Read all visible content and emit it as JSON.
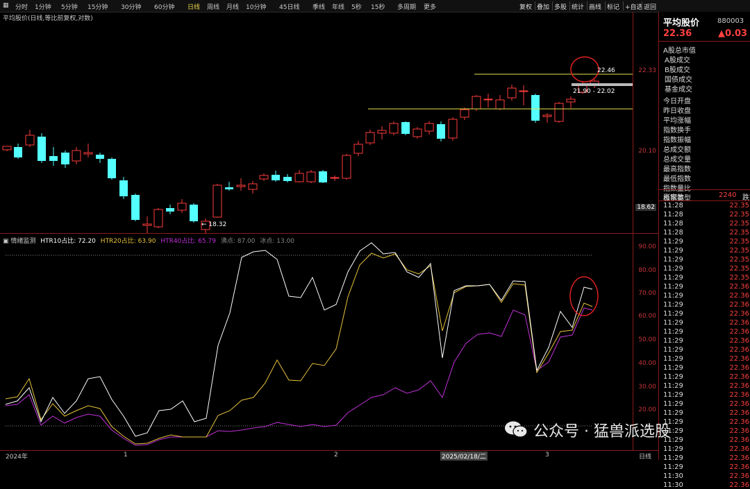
{
  "toolbar": {
    "timeframes": [
      "分时",
      "1分钟",
      "5分钟",
      "15分钟",
      "30分钟",
      "60分钟",
      "日线",
      "周线",
      "月线",
      "10分钟",
      "45日线",
      "季线",
      "年线",
      "5秒",
      "15秒",
      "多周期",
      "更多"
    ],
    "active": "日线",
    "right_buttons": [
      "复权",
      "叠加",
      "多股",
      "统计",
      "画线",
      "标记",
      "+自选",
      "返回"
    ]
  },
  "main": {
    "title": "平均股价(日线,等比前复权,对数)",
    "high_label": "22.46",
    "low_label": "← 18.32",
    "range_label": "21.90 - 22.02",
    "axis": [
      "22.33",
      "20.10",
      "18.62"
    ]
  },
  "indicator": {
    "title": "情绪监测",
    "htr10": "HTR10占比: 72.20",
    "htr20": "HTR20占比: 63.90",
    "htr40": "HTR40占比: 65.79",
    "hot": "沸点: 87.00",
    "cold": "冰点: 13.00",
    "axis": [
      "90.00",
      "80.00",
      "70.00",
      "60.00",
      "50.00",
      "40.00",
      "30.00",
      "20.00"
    ],
    "colors": {
      "htr10": "#ffffff",
      "htr20": "#e8c43a",
      "htr40": "#c030d8"
    }
  },
  "dates": {
    "y2024": "2024年",
    "m1": "1",
    "m2": "2",
    "highlight": "2025/02/18/二",
    "m3": "3",
    "period": "日线"
  },
  "panel": {
    "name": "平均股价",
    "code": "880003",
    "price": "22.36",
    "change": "▲0.03",
    "items": [
      "A股总市值",
      "A股成交",
      "B股成交",
      "国债成交",
      "基金成交",
      "今日开盘",
      "昨日收盘",
      "平均涨幅",
      "指数换手",
      "指数振幅",
      "总成交额",
      "总成交量",
      "最高指数",
      "最低指数",
      "指数量比",
      "板指类型"
    ],
    "up_label": "涨家数",
    "up_count": "2240",
    "down_label": "跌家",
    "ticks": [
      [
        "11:28",
        "22.35"
      ],
      [
        "11:28",
        "22.35"
      ],
      [
        "11:28",
        "22.35"
      ],
      [
        "11:28",
        "22.35"
      ],
      [
        "11:29",
        "22.35"
      ],
      [
        "11:29",
        "22.35"
      ],
      [
        "11:29",
        "22.35"
      ],
      [
        "11:29",
        "22.35"
      ],
      [
        "11:29",
        "22.35"
      ],
      [
        "11:29",
        "22.36"
      ],
      [
        "11:29",
        "22.36"
      ],
      [
        "11:29",
        "22.36"
      ],
      [
        "11:29",
        "22.36"
      ],
      [
        "11:29",
        "22.36"
      ],
      [
        "11:29",
        "22.36"
      ],
      [
        "11:29",
        "22.36"
      ],
      [
        "11:29",
        "22.36"
      ],
      [
        "11:29",
        "22.36"
      ],
      [
        "11:29",
        "22.36"
      ],
      [
        "11:29",
        "22.36"
      ],
      [
        "11:29",
        "22.36"
      ],
      [
        "11:29",
        "22.36"
      ],
      [
        "11:29",
        "22.36"
      ],
      [
        "11:29",
        "22.36"
      ],
      [
        "11:29",
        "22.36"
      ],
      [
        "11:29",
        "22.36"
      ],
      [
        "11:29",
        "22.36"
      ],
      [
        "11:29",
        "22.36"
      ],
      [
        "11:29",
        "22.36"
      ],
      [
        "11:29",
        "22.36"
      ],
      [
        "11:30",
        "22.36"
      ],
      [
        "11:30",
        "22.36"
      ]
    ]
  },
  "watermark": "公众号 · 猛兽派选股",
  "candles": [
    [
      4,
      197,
      201,
      199,
      194,
      0
    ],
    [
      20,
      190,
      212,
      195,
      210,
      1
    ],
    [
      37,
      170,
      195,
      192,
      178,
      0
    ],
    [
      54,
      175,
      218,
      180,
      215,
      1
    ],
    [
      71,
      195,
      222,
      208,
      215,
      1
    ],
    [
      88,
      200,
      225,
      203,
      220,
      1
    ],
    [
      104,
      195,
      220,
      215,
      200,
      0
    ],
    [
      121,
      190,
      210,
      203,
      205,
      0
    ],
    [
      138,
      203,
      218,
      206,
      212,
      1
    ],
    [
      155,
      210,
      242,
      212,
      240,
      1
    ],
    [
      172,
      238,
      270,
      243,
      266,
      1
    ],
    [
      189,
      262,
      302,
      264,
      300,
      1
    ],
    [
      206,
      295,
      322,
      306,
      308,
      0
    ],
    [
      222,
      283,
      312,
      310,
      285,
      0
    ],
    [
      239,
      278,
      292,
      283,
      288,
      1
    ],
    [
      256,
      270,
      290,
      286,
      276,
      0
    ],
    [
      273,
      276,
      304,
      278,
      302,
      1
    ],
    [
      290,
      298,
      320,
      314,
      302,
      0
    ],
    [
      307,
      248,
      297,
      296,
      250,
      0
    ],
    [
      324,
      245,
      258,
      253,
      256,
      1
    ],
    [
      341,
      240,
      258,
      252,
      250,
      0
    ],
    [
      358,
      244,
      262,
      256,
      248,
      0
    ],
    [
      374,
      233,
      244,
      241,
      236,
      0
    ],
    [
      391,
      229,
      245,
      235,
      243,
      1
    ],
    [
      408,
      234,
      246,
      238,
      244,
      1
    ],
    [
      425,
      228,
      246,
      245,
      233,
      0
    ],
    [
      442,
      228,
      247,
      245,
      231,
      0
    ],
    [
      459,
      228,
      247,
      230,
      246,
      1
    ],
    [
      476,
      236,
      244,
      239,
      239,
      0
    ],
    [
      493,
      205,
      242,
      240,
      207,
      0
    ],
    [
      510,
      186,
      208,
      204,
      191,
      0
    ],
    [
      527,
      170,
      192,
      189,
      174,
      0
    ],
    [
      544,
      165,
      184,
      171,
      175,
      0
    ],
    [
      561,
      158,
      178,
      175,
      161,
      0
    ],
    [
      578,
      158,
      178,
      159,
      176,
      1
    ],
    [
      595,
      166,
      183,
      180,
      169,
      0
    ],
    [
      612,
      158,
      177,
      172,
      161,
      0
    ],
    [
      629,
      158,
      187,
      162,
      183,
      1
    ],
    [
      646,
      152,
      186,
      182,
      155,
      0
    ],
    [
      663,
      138,
      156,
      152,
      141,
      0
    ],
    [
      680,
      120,
      143,
      140,
      122,
      0
    ],
    [
      697,
      118,
      138,
      126,
      127,
      0
    ],
    [
      714,
      120,
      142,
      140,
      127,
      0
    ],
    [
      731,
      105,
      128,
      110,
      124,
      0
    ],
    [
      748,
      106,
      135,
      114,
      114,
      0
    ],
    [
      765,
      118,
      160,
      120,
      157,
      1
    ],
    [
      782,
      146,
      160,
      149,
      151,
      0
    ],
    [
      799,
      130,
      160,
      158,
      132,
      0
    ],
    [
      816,
      122,
      139,
      130,
      126,
      0
    ],
    [
      833,
      100,
      118,
      116,
      104,
      0
    ],
    [
      850,
      97,
      110,
      106,
      100,
      0
    ]
  ]
}
